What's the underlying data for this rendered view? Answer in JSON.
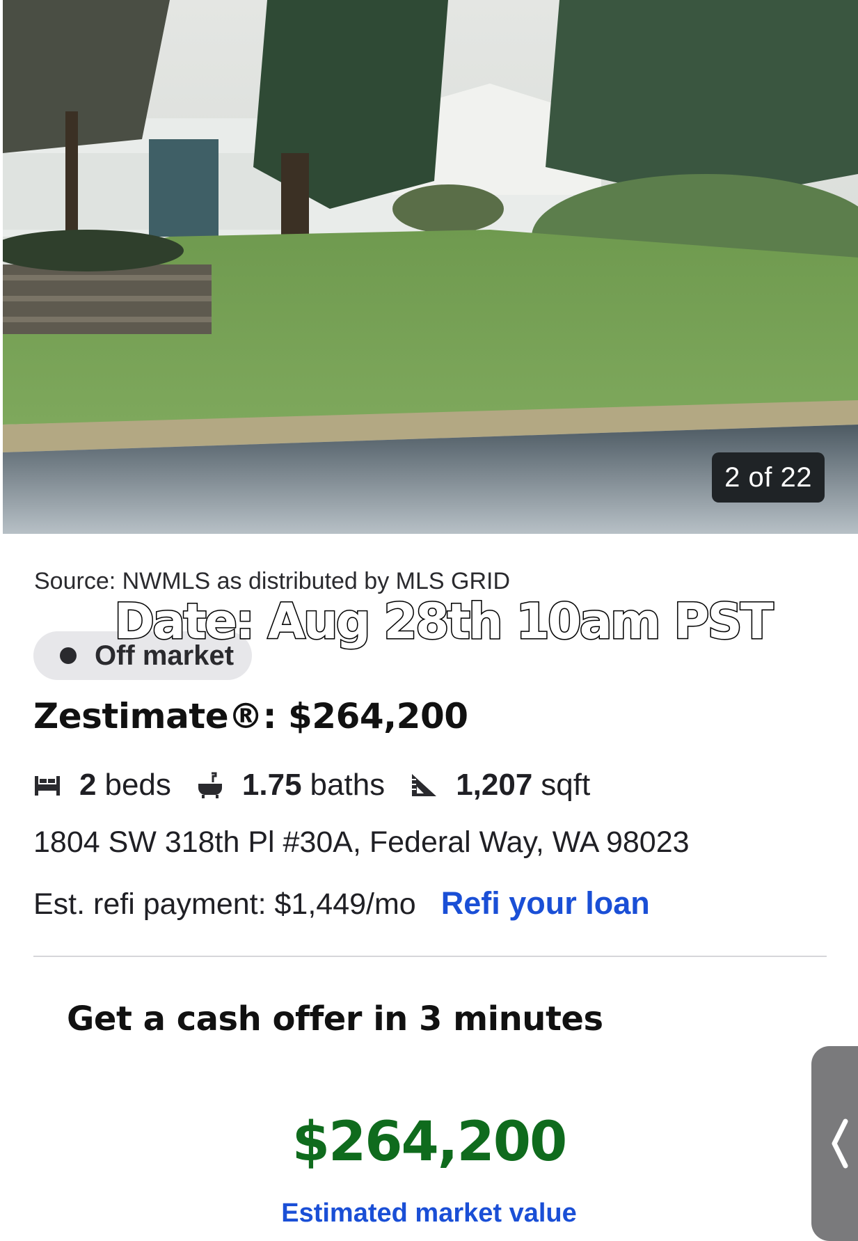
{
  "photo": {
    "counter": "2 of 22"
  },
  "listing": {
    "source": "Source: NWMLS as distributed by MLS GRID",
    "status": "Off market",
    "zestimate": "Zestimate®: $264,200",
    "beds_value": "2",
    "beds_label": "beds",
    "baths_value": "1.75",
    "baths_label": "baths",
    "sqft_value": "1,207",
    "sqft_label": "sqft",
    "address": "1804 SW 318th Pl #30A, Federal Way, WA 98023",
    "refi_payment": "Est. refi payment: $1,449/mo",
    "refi_link": "Refi your loan"
  },
  "overlay": {
    "date_text": "Date: Aug 28th 10am PST"
  },
  "cash_offer": {
    "title": "Get a cash offer in 3 minutes",
    "value": "$264,200",
    "subtitle": "Estimated market value"
  },
  "icons": {
    "beds": "bed-icon",
    "baths": "bathtub-icon",
    "sqft": "ruler-triangle-icon",
    "handle": "chevron-left-icon"
  },
  "colors": {
    "link": "#1a4fd6",
    "value_green": "#0f6b1d"
  }
}
